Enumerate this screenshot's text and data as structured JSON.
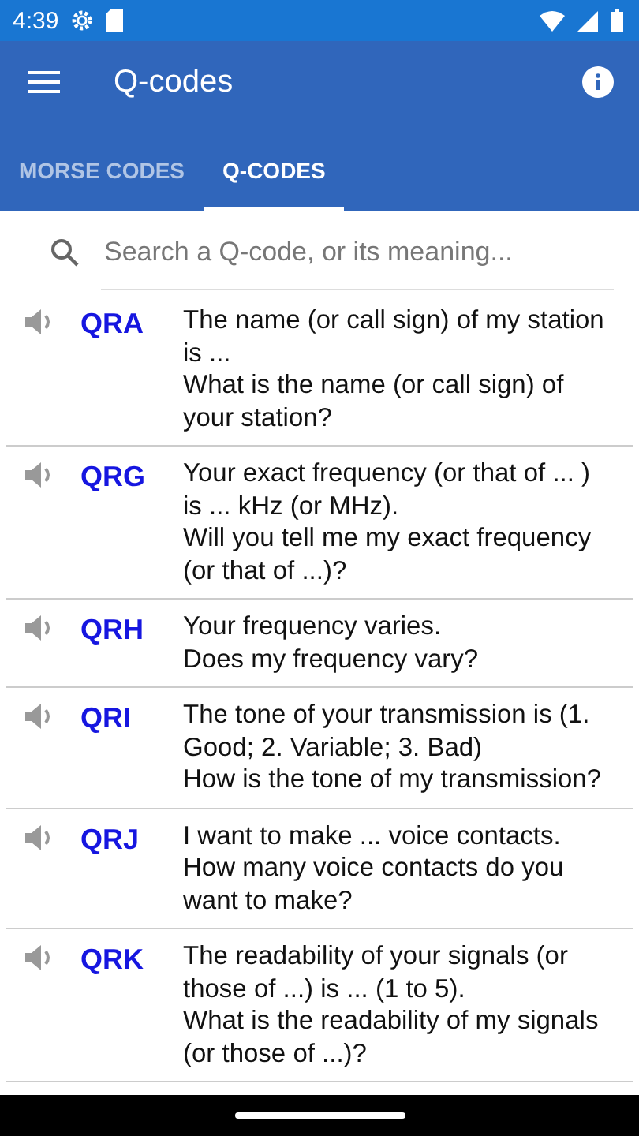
{
  "status_bar": {
    "time": "4:39"
  },
  "app_bar": {
    "title": "Q-codes"
  },
  "tabs": [
    {
      "label": "MORSE CODES",
      "selected": false
    },
    {
      "label": "Q-CODES",
      "selected": true
    }
  ],
  "search": {
    "placeholder": "Search a Q-code, or its meaning..."
  },
  "codes": [
    {
      "code": "QRA",
      "meaning": "The name (or call sign) of my station is ...",
      "question": "What is the name (or call sign) of your station?"
    },
    {
      "code": "QRG",
      "meaning": "Your exact frequency (or that of ... ) is ... kHz (or MHz).",
      "question": "Will you tell me my exact frequency (or that of ...)?"
    },
    {
      "code": "QRH",
      "meaning": "Your frequency varies.",
      "question": "Does my frequency vary?"
    },
    {
      "code": "QRI",
      "meaning": "The tone of your transmission is (1. Good; 2. Variable; 3. Bad)",
      "question": "How is the tone of my transmission?"
    },
    {
      "code": "QRJ",
      "meaning": "I want to make ... voice contacts.",
      "question": "How many voice contacts do you want to make?"
    },
    {
      "code": "QRK",
      "meaning": "The readability of your signals (or those of ...) is ... (1 to 5).",
      "question": "What is the readability of my signals (or those of ...)?"
    }
  ]
}
